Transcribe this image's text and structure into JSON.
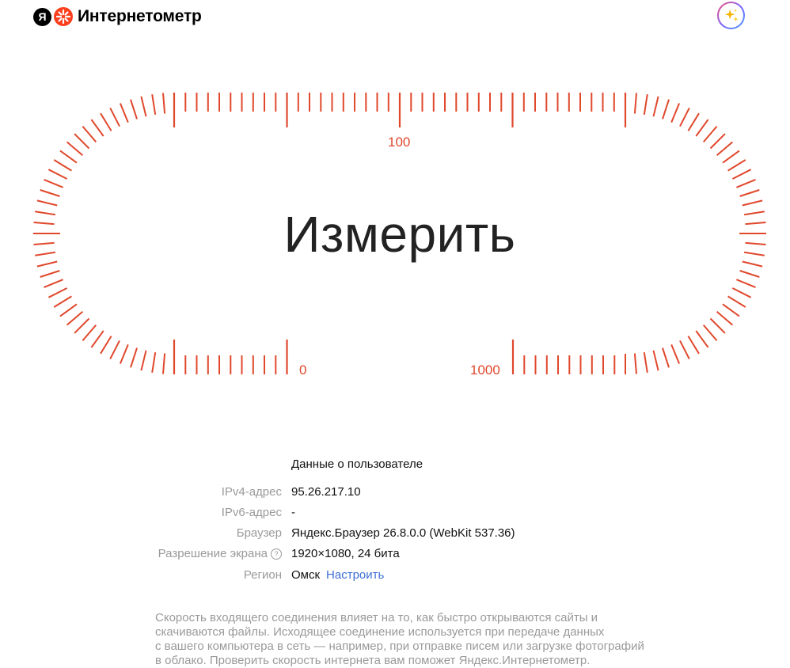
{
  "header": {
    "logo_letter": "Я",
    "brand": "Интернетометр",
    "ai_icon": "sparkles-icon"
  },
  "gauge": {
    "action_label": "Измерить",
    "scale_labels": {
      "top": "100",
      "left_bottom": "0",
      "right_bottom": "1000"
    },
    "color": "#e0482c"
  },
  "user_info": {
    "title": "Данные о пользователе",
    "rows": [
      {
        "key": "IPv4-адрес",
        "value": "95.26.217.10"
      },
      {
        "key": "IPv6-адрес",
        "value": "-"
      },
      {
        "key": "Браузер",
        "value": "Яндекс.Браузер 26.8.0.0 (WebKit 537.36)"
      },
      {
        "key": "Разрешение экрана",
        "value": "1920×1080, 24 бита",
        "help_icon": "?"
      },
      {
        "key": "Регион",
        "value": "Омск",
        "link": "Настроить"
      }
    ]
  },
  "description": [
    "Скорость входящего соединения влияет на то, как быстро открываются сайты и",
    "скачиваются файлы. Исходящее соединение используется при передаче данных",
    "с вашего компьютера в сеть — например, при отправке писем или загрузке фотографий",
    "в облако. Проверить скорость интернета вам поможет Яндекс.Интернетометр."
  ],
  "colors": {
    "accent": "#e0482c",
    "link": "#3e6fd4",
    "muted": "#9a9a9a"
  }
}
